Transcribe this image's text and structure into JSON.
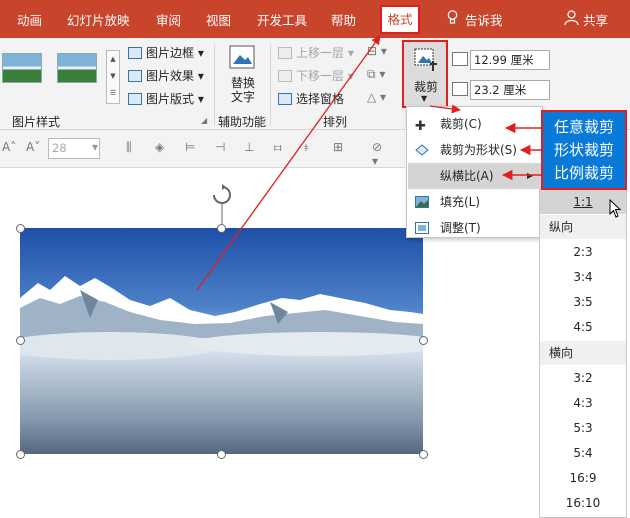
{
  "titlebar": {
    "tabs": [
      "动画",
      "幻灯片放映",
      "审阅",
      "视图",
      "开发工具",
      "帮助"
    ],
    "active_tab": "格式",
    "tell_me": "告诉我",
    "share": "共享",
    "bar_color": "#c8452c"
  },
  "ribbon": {
    "picture_styles_label": "图片样式",
    "picture_border": "图片边框",
    "picture_effects": "图片效果",
    "picture_layout": "图片版式",
    "alt_text_line1": "替换",
    "alt_text_line2": "文字",
    "accessibility_label": "辅助功能",
    "bring_forward": "上移一层",
    "send_backward": "下移一层",
    "selection_pane": "选择窗格",
    "arrange_label": "排列",
    "crop_button": "裁剪",
    "height_value": "12.99 厘米",
    "width_value": "23.2 厘米"
  },
  "toolbar2": {
    "font_size": "28"
  },
  "crop_menu": {
    "items": [
      {
        "label": "裁剪(C)",
        "icon": "crop-icon"
      },
      {
        "label": "裁剪为形状(S)",
        "icon": "crop-to-shape-icon"
      },
      {
        "label": "纵横比(A)",
        "icon": "aspect-ratio-arrow"
      },
      {
        "label": "填充(L)",
        "icon": "fill-icon"
      },
      {
        "label": "调整(T)",
        "icon": "fit-icon"
      }
    ]
  },
  "aspect_menu": {
    "square": "1:1",
    "portrait_header": "纵向",
    "portrait": [
      "2:3",
      "3:4",
      "3:5",
      "4:5"
    ],
    "landscape_header": "横向",
    "landscape": [
      "3:2",
      "4:3",
      "5:3",
      "5:4",
      "16:9",
      "16:10"
    ]
  },
  "annotation": {
    "lines": [
      "任意裁剪",
      "形状裁剪",
      "比例裁剪"
    ],
    "box_color": "#0a7ad8",
    "arrow_color": "#e02020"
  }
}
